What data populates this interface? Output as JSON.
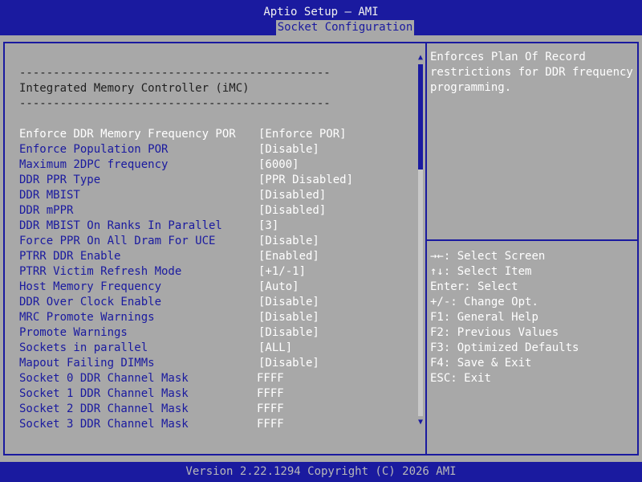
{
  "header": {
    "title": "Aptio Setup – AMI",
    "tab": "Socket Configuration"
  },
  "main": {
    "dashes_top": "----------------------------------------------",
    "section_title": "Integrated Memory Controller (iMC)",
    "dashes_bottom": "----------------------------------------------",
    "settings": [
      {
        "label": "Enforce DDR Memory Frequency POR",
        "value": "[Enforce POR]"
      },
      {
        "label": "Enforce Population POR",
        "value": "[Disable]"
      },
      {
        "label": "Maximum 2DPC frequency",
        "value": "[6000]"
      },
      {
        "label": "DDR PPR Type",
        "value": "[PPR Disabled]"
      },
      {
        "label": "DDR MBIST",
        "value": "[Disabled]"
      },
      {
        "label": "DDR mPPR",
        "value": "[Disabled]"
      },
      {
        "label": "DDR MBIST On Ranks In Parallel",
        "value": "[3]"
      },
      {
        "label": "Force PPR On All Dram For UCE",
        "value": "[Disable]"
      },
      {
        "label": "PTRR DDR Enable",
        "value": "[Enabled]"
      },
      {
        "label": "PTRR Victim Refresh Mode",
        "value": "[+1/-1]"
      },
      {
        "label": "Host Memory Frequency",
        "value": "[Auto]"
      },
      {
        "label": "DDR Over Clock Enable",
        "value": "[Disable]"
      },
      {
        "label": "MRC Promote Warnings",
        "value": "[Disable]"
      },
      {
        "label": "Promote Warnings",
        "value": "[Disable]"
      },
      {
        "label": "Sockets in parallel",
        "value": "[ALL]"
      },
      {
        "label": "Mapout Failing DIMMs",
        "value": "[Disable]"
      },
      {
        "label": "Socket 0 DDR Channel Mask",
        "value": "FFFF"
      },
      {
        "label": "Socket 1 DDR Channel Mask",
        "value": "FFFF"
      },
      {
        "label": "Socket 2 DDR Channel Mask",
        "value": "FFFF"
      },
      {
        "label": "Socket 3 DDR Channel Mask",
        "value": "FFFF"
      }
    ]
  },
  "help": {
    "description": "Enforces Plan Of Record restrictions for DDR frequency programming.",
    "keys": [
      {
        "key": "→←:",
        "action": "Select Screen"
      },
      {
        "key": "↑↓:",
        "action": "Select Item"
      },
      {
        "key": "Enter:",
        "action": "Select"
      },
      {
        "key": "+/-:",
        "action": "Change Opt."
      },
      {
        "key": "F1:",
        "action": "General Help"
      },
      {
        "key": "F2:",
        "action": "Previous Values"
      },
      {
        "key": "F3:",
        "action": "Optimized Defaults"
      },
      {
        "key": "F4:",
        "action": "Save & Exit"
      },
      {
        "key": "ESC:",
        "action": "Exit"
      }
    ]
  },
  "scrollbar": {
    "up_icon": "▲",
    "down_icon": "▼",
    "position_fraction": 0.0,
    "visible_fraction": 0.3
  },
  "footer": {
    "version": "Version 2.22.1294 Copyright (C) 2026 AMI"
  },
  "colors": {
    "background": "#a8a8a8",
    "accent_blue": "#1a1a9f",
    "text_white": "#ffffff",
    "text_dark": "#202020"
  }
}
